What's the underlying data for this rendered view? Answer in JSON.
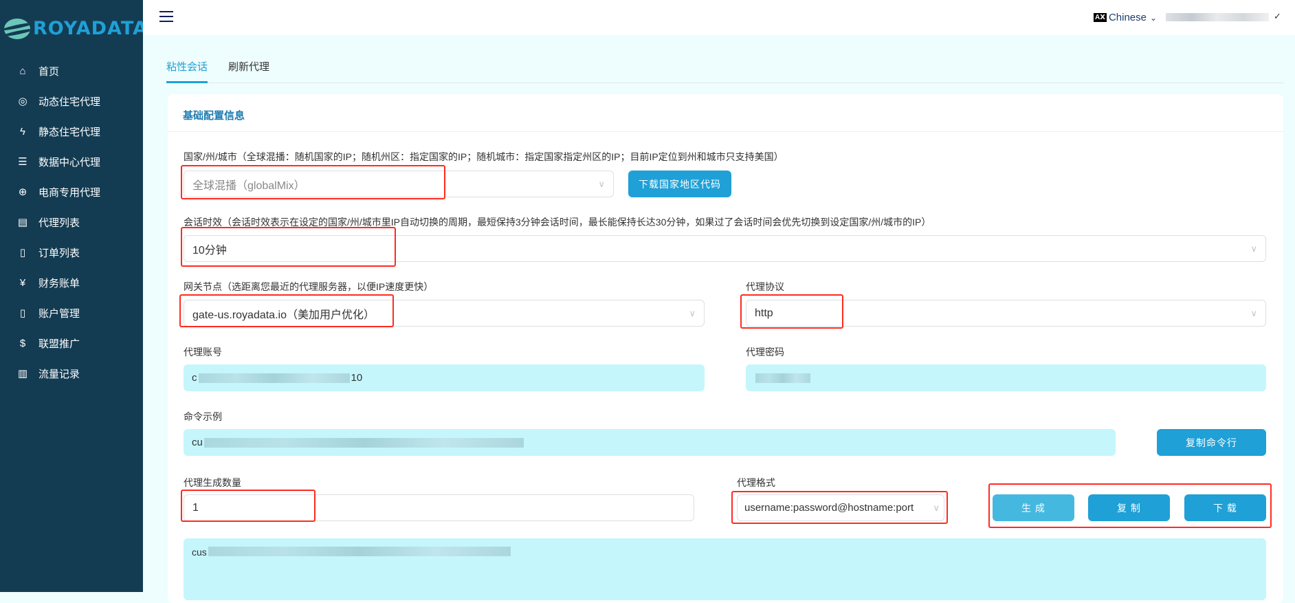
{
  "brand": {
    "name": "ROYADATA"
  },
  "sidebar": {
    "items": [
      {
        "label": "首页",
        "icon": "home-icon",
        "glyph": "⌂"
      },
      {
        "label": "动态住宅代理",
        "icon": "location-pin-icon",
        "glyph": "◎"
      },
      {
        "label": "静态住宅代理",
        "icon": "lightning-icon",
        "glyph": "ϟ"
      },
      {
        "label": "数据中心代理",
        "icon": "server-icon",
        "glyph": "☰"
      },
      {
        "label": "电商专用代理",
        "icon": "globe-icon",
        "glyph": "⊕"
      },
      {
        "label": "代理列表",
        "icon": "store-icon",
        "glyph": "▤"
      },
      {
        "label": "订单列表",
        "icon": "order-search-icon",
        "glyph": "▯"
      },
      {
        "label": "财务账单",
        "icon": "bill-icon",
        "glyph": "¥"
      },
      {
        "label": "账户管理",
        "icon": "account-icon",
        "glyph": "▯"
      },
      {
        "label": "联盟推广",
        "icon": "dollar-icon",
        "glyph": "$"
      },
      {
        "label": "流量记录",
        "icon": "bar-chart-icon",
        "glyph": "▥"
      }
    ]
  },
  "header": {
    "language": "Chinese",
    "lang_icon": "AⅩ"
  },
  "tabs": [
    {
      "label": "粘性会话"
    },
    {
      "label": "刷新代理"
    }
  ],
  "card": {
    "title": "基础配置信息"
  },
  "form": {
    "country_label": "国家/州/城市（全球混播：随机国家的IP；随机州区：指定国家的IP；随机城市：指定国家指定州区的IP；目前IP定位到州和城市只支持美国）",
    "country_value": "全球混播（globalMix）",
    "download_codes_button": "下载国家地区代码",
    "session_label": "会话时效（会话时效表示在设定的国家/州/城市里IP自动切换的周期，最短保持3分钟会话时间，最长能保持长达30分钟，如果过了会话时间会优先切换到设定国家/州/城市的IP）",
    "session_value": "10分钟",
    "gateway_label": "网关节点（选距离您最近的代理服务器，以便IP速度更快）",
    "gateway_value": "gate-us.royadata.io（美加用户优化）",
    "protocol_label": "代理协议",
    "protocol_value": "http",
    "account_label": "代理账号",
    "account_prefix": "c",
    "account_suffix": "10",
    "password_label": "代理密码",
    "command_label": "命令示例",
    "command_prefix": "cu",
    "copy_command_button": "复制命令行",
    "count_label": "代理生成数量",
    "count_value": "1",
    "format_label": "代理格式",
    "format_value": "username:password@hostname:port",
    "generate_button": "生 成",
    "copy_button": "复 制",
    "download_button": "下 载",
    "output_prefix": "cus"
  }
}
